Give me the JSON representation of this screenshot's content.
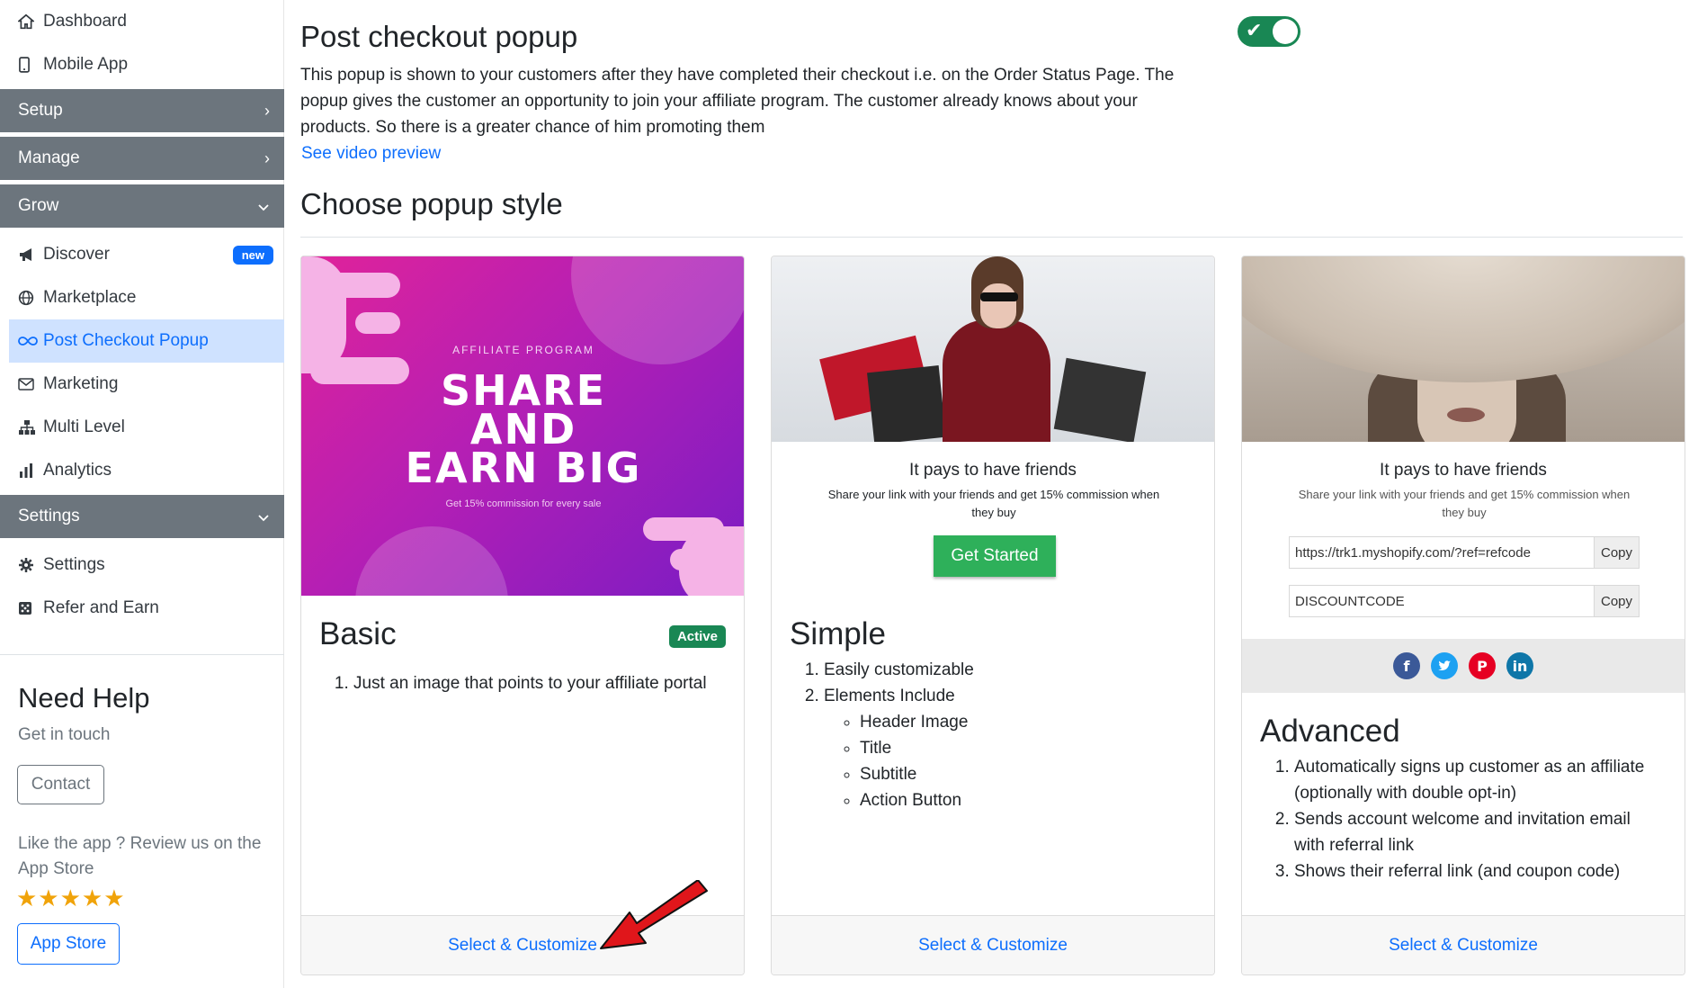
{
  "sidebar": {
    "top_items": [
      {
        "label": "Dashboard",
        "icon": "home-icon"
      },
      {
        "label": "Mobile App",
        "icon": "phone-icon"
      }
    ],
    "sections": {
      "setup": "Setup",
      "manage": "Manage",
      "grow": "Grow",
      "settings": "Settings"
    },
    "grow_items": [
      {
        "label": "Discover",
        "icon": "megaphone-icon",
        "badge": "new"
      },
      {
        "label": "Marketplace",
        "icon": "globe-icon"
      },
      {
        "label": "Post Checkout Popup",
        "icon": "infinity-icon",
        "active": true
      },
      {
        "label": "Marketing",
        "icon": "envelope-icon"
      },
      {
        "label": "Multi Level",
        "icon": "hierarchy-icon"
      },
      {
        "label": "Analytics",
        "icon": "bar-chart-icon"
      }
    ],
    "settings_items": [
      {
        "label": "Settings",
        "icon": "gear-icon"
      },
      {
        "label": "Refer and Earn",
        "icon": "dice-icon"
      }
    ],
    "help": {
      "title": "Need Help",
      "subtitle": "Get in touch",
      "contact_button": "Contact",
      "review_text": "Like the app ? Review us on the App Store",
      "stars": "★★★★★",
      "appstore_button": "App Store"
    }
  },
  "main": {
    "title": "Post checkout popup",
    "toggle_enabled": true,
    "description": "This popup is shown to your customers after they have completed their checkout i.e. on the Order Status Page. The popup gives the customer an opportunity to join your affiliate program. The customer already knows about your products. So there is a greater chance of him promoting them",
    "video_link": "See video preview",
    "choose_title": "Choose popup style",
    "cards": {
      "basic": {
        "image_kicker": "AFFILIATE PROGRAM",
        "image_headline_1": "SHARE",
        "image_headline_2": "AND",
        "image_headline_3": "EARN BIG",
        "image_small": "Get 15% commission for every sale",
        "title": "Basic",
        "badge": "Active",
        "features": [
          "Just an image that points to your affiliate portal"
        ],
        "footer": "Select & Customize"
      },
      "simple": {
        "preview_heading": "It pays to have friends",
        "preview_sub": "Share your link with your friends and get 15% commission when they buy",
        "preview_button": "Get Started",
        "title": "Simple",
        "features": [
          "Easily customizable",
          "Elements Include"
        ],
        "sub_features": [
          "Header Image",
          "Title",
          "Subtitle",
          "Action Button"
        ],
        "footer": "Select & Customize"
      },
      "advanced": {
        "preview_heading": "It pays to have friends",
        "preview_sub": "Share your link with your friends and get 15% commission when they buy",
        "link_value": "https://trk1.myshopify.com/?ref=refcode",
        "code_value": "DISCOUNTCODE",
        "copy_label": "Copy",
        "title": "Advanced",
        "features": [
          "Automatically signs up customer as an affiliate (optionally with double opt-in)",
          "Sends account welcome and invitation email with referral link",
          "Shows their referral link (and coupon code)"
        ],
        "footer": "Select & Customize"
      }
    }
  },
  "colors": {
    "accent": "#0d6efd",
    "section_bg": "#6c757d",
    "active_bg": "#cfe2ff",
    "success": "#198754",
    "arrow": "#e0161b"
  }
}
